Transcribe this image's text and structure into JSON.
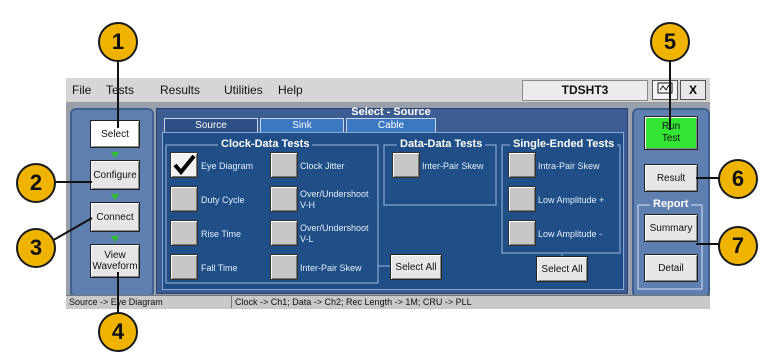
{
  "menu": {
    "file": "File",
    "tests": "Tests",
    "results": "Results",
    "utilities": "Utilities",
    "help": "Help"
  },
  "app_name": "TDSHT3",
  "window_controls": {
    "close": "X",
    "icon": "minimize-icon"
  },
  "nav": {
    "select": "Select",
    "configure": "Configure",
    "connect": "Connect",
    "view_line1": "View",
    "view_line2": "Waveform"
  },
  "panel_title": "Select - Source",
  "tabs": [
    "Source",
    "Sink",
    "Cable"
  ],
  "groups": {
    "clock_data": "Clock-Data Tests",
    "data_data": "Data-Data Tests",
    "single_ended": "Single-Ended Tests"
  },
  "tests": {
    "eye_diagram": "Eye Diagram",
    "duty_cycle": "Duty Cycle",
    "rise_time": "Rise Time",
    "fall_time": "Fall Time",
    "clock_jitter": "Clock Jitter",
    "over_under_vh_1": "Over/Undershoot",
    "over_under_vh_2": "V-H",
    "over_under_vl_1": "Over/Undershoot",
    "over_under_vl_2": "V-L",
    "inter_pair_skew_cd": "Inter-Pair Skew",
    "inter_pair_skew_dd": "Inter-Pair Skew",
    "intra_pair_skew": "Intra-Pair Skew",
    "low_amp_plus": "Low Amplitude +",
    "low_amp_minus": "Low Amplitude -"
  },
  "select_all_1": "Select All",
  "select_all_2": "Select All",
  "right": {
    "run_line1": "Run",
    "run_line2": "Test",
    "result": "Result",
    "report": "Report",
    "summary": "Summary",
    "detail": "Detail"
  },
  "status": {
    "left": "Source -> Eye Diagram",
    "right": "Clock -> Ch1; Data -> Ch2; Rec Length -> 1M; CRU -> PLL"
  },
  "callouts": [
    "1",
    "2",
    "3",
    "4",
    "5",
    "6",
    "7"
  ],
  "colors": {
    "callout": "#f0b400",
    "run_button": "#33e633",
    "panel": "#5f7fb0",
    "pane": "#1f4f86"
  }
}
